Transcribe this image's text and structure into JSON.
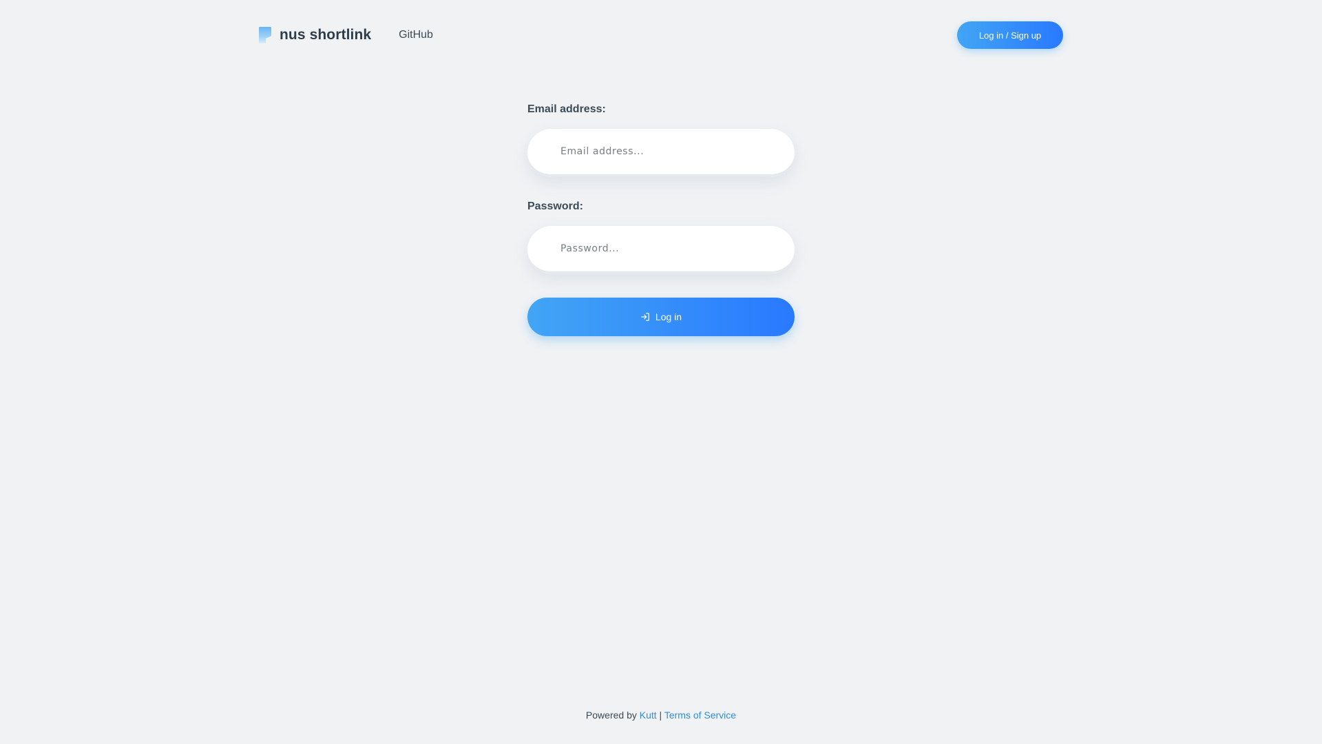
{
  "header": {
    "brand_name": "nus shortlink",
    "nav_github": "GitHub",
    "auth_button": "Log in / Sign up"
  },
  "form": {
    "email_label": "Email address:",
    "email_placeholder": "Email address...",
    "email_value": "",
    "password_label": "Password:",
    "password_placeholder": "Password...",
    "password_value": "",
    "submit_label": "Log in",
    "submit_icon": "login-icon"
  },
  "footer": {
    "powered_by": "Powered by",
    "kutt_link": "Kutt",
    "separator": "|",
    "terms_link": "Terms of Service"
  },
  "colors": {
    "background": "#f0f2f4",
    "accent_start": "#42a5f5",
    "accent_end": "#2979ff",
    "link": "#2f8ce8",
    "text": "#2d3d4a"
  }
}
